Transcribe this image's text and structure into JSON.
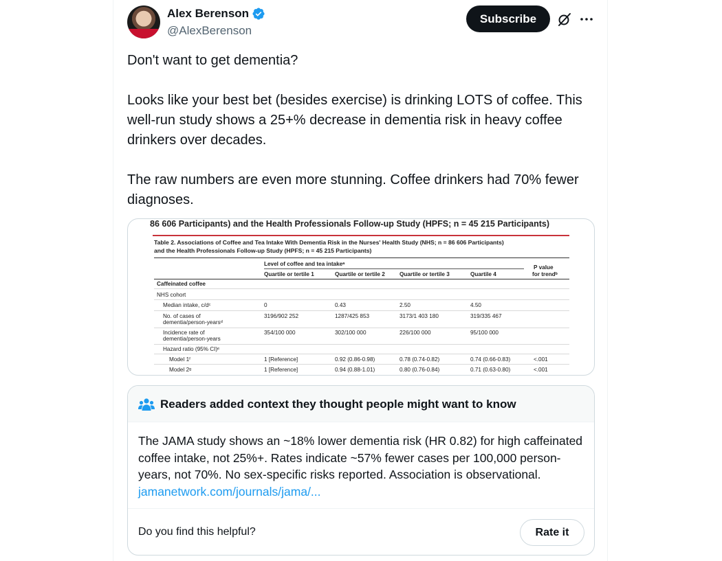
{
  "author": {
    "display_name": "Alex Berenson",
    "handle": "@AlexBerenson",
    "verified": true,
    "verified_color": "#1d9bf0"
  },
  "actions": {
    "subscribe_label": "Subscribe",
    "grok_icon": "grok-icon",
    "more_icon": "more-dots-icon"
  },
  "tweet": {
    "paragraphs": [
      "Don't want to get dementia?",
      "Looks like your best bet (besides exercise) is drinking LOTS of coffee. This well-run study shows a 25+% decrease in dementia risk in heavy coffee drinkers over decades.",
      "The raw numbers are even more stunning. Coffee drinkers had 70% fewer diagnoses."
    ]
  },
  "media": {
    "heading": "86 606 Participants) and the Health Professionals Follow-up Study (HPFS; n = 45 215 Participants)",
    "caption_line1": "Table 2. Associations of Coffee and Tea Intake With Dementia Risk in the Nurses' Health Study (NHS; n = 86 606 Participants)",
    "caption_line2": "and the Health Professionals Follow-up Study (HPFS; n = 45 215 Participants)",
    "group_header": "Level of coffee and tea intakeᵃ",
    "pvalue_header_1": "P value",
    "pvalue_header_2": "for trendᵇ",
    "columns": [
      "Quartile or tertile 1",
      "Quartile or tertile 2",
      "Quartile or tertile 3",
      "Quartile 4"
    ],
    "section": "Caffeinated coffee",
    "cohort": "NHS cohort",
    "rows": [
      {
        "label1": "Median intake, c/dᶜ",
        "label2": "",
        "cells": [
          "0",
          "0.43",
          "2.50",
          "4.50",
          ""
        ]
      },
      {
        "label1": "No. of cases of",
        "label2": "dementia/person-yearsᵈ",
        "cells": [
          "3196/902 252",
          "1287/425 853",
          "3173/1 403 180",
          "319/335 467",
          ""
        ]
      },
      {
        "label1": "Incidence rate of",
        "label2": "dementia/person-years",
        "cells": [
          "354/100 000",
          "302/100 000",
          "226/100 000",
          "95/100 000",
          ""
        ]
      },
      {
        "label1": "Hazard ratio (95% CI)ᵉ",
        "label2": "",
        "cells": [
          "",
          "",
          "",
          "",
          ""
        ]
      },
      {
        "label1": "Model 1ᶠ",
        "label2": "",
        "cells": [
          "1 [Reference]",
          "0.92 (0.86-0.98)",
          "0.78 (0.74-0.82)",
          "0.74 (0.66-0.83)",
          "<.001"
        ]
      },
      {
        "label1": "Model 2ᵍ",
        "label2": "",
        "cells": [
          "1 [Reference]",
          "0.94 (0.88-1.01)",
          "0.80 (0.76-0.84)",
          "0.71 (0.63-0.80)",
          "<.001"
        ]
      }
    ]
  },
  "note": {
    "title": "Readers added context they thought people might want to know",
    "body": "The JAMA study shows an ~18% lower dementia risk (HR 0.82) for high caffeinated coffee intake, not 25%+. Rates indicate ~57% fewer cases per 100,000 person-years, not 70%. No sex-specific risks reported. Association is observational. ",
    "link_text": "jamanetwork.com/journals/jama/...",
    "helpful_question": "Do you find this helpful?",
    "rate_label": "Rate it",
    "accent_color": "#1d9bf0"
  }
}
